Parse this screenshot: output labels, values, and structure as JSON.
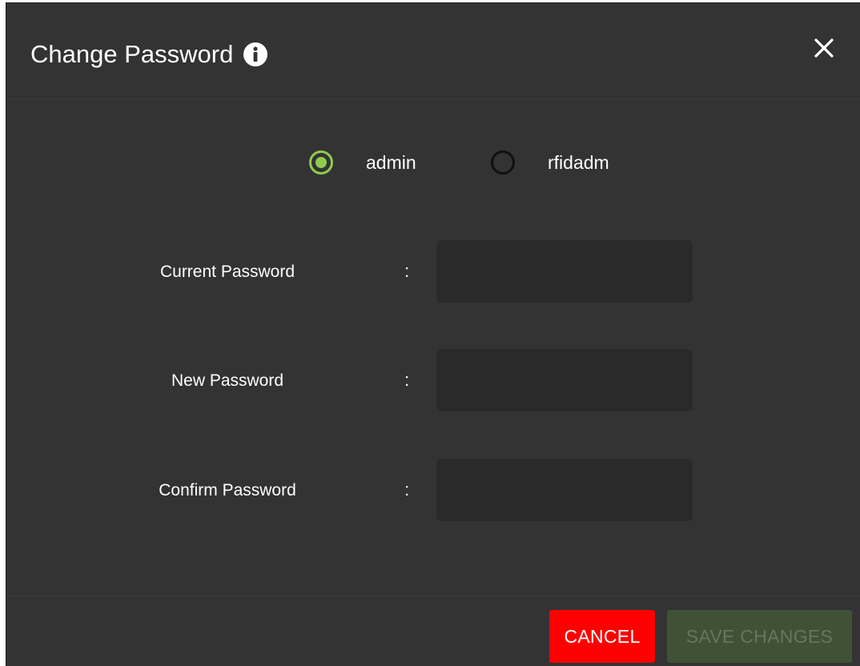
{
  "dialog": {
    "title": "Change Password",
    "info_icon": "info-circle-icon",
    "close_icon": "close-x-icon"
  },
  "user_selection": {
    "options": [
      {
        "label": "admin",
        "checked": true
      },
      {
        "label": "rfidadm",
        "checked": false
      }
    ]
  },
  "form": {
    "separator": ":",
    "fields": [
      {
        "label": "Current Password",
        "value": "",
        "placeholder": ""
      },
      {
        "label": "New Password",
        "value": "",
        "placeholder": ""
      },
      {
        "label": "Confirm Password",
        "value": "",
        "placeholder": ""
      }
    ]
  },
  "footer": {
    "cancel_label": "CANCEL",
    "save_label": "SAVE CHANGES",
    "save_enabled": false
  },
  "colors": {
    "dialog_bg": "#333333",
    "input_bg": "#2a2a2a",
    "accent_green": "#8fcb4f",
    "cancel_red": "#ff0000",
    "save_disabled_bg": "#3f5236"
  }
}
